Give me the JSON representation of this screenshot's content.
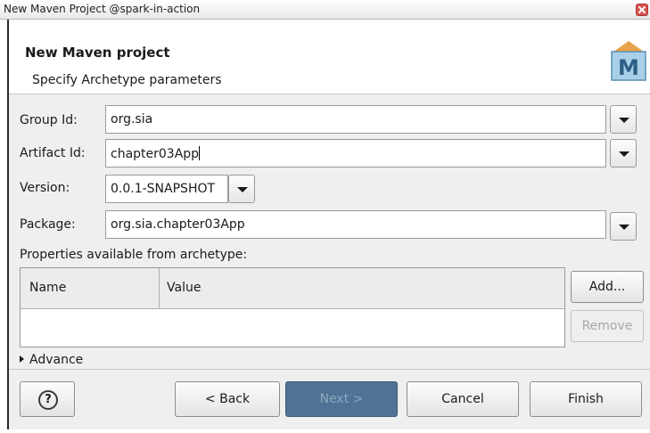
{
  "window": {
    "title": "New Maven Project @spark-in-action"
  },
  "banner": {
    "heading": "New Maven project",
    "subheading": "Specify Archetype parameters",
    "logo_letter": "M"
  },
  "form": {
    "group_id": {
      "label": "Group Id:",
      "value": "org.sia"
    },
    "artifact_id": {
      "label": "Artifact Id:",
      "value": "chapter03App"
    },
    "version": {
      "label": "Version:",
      "value": "0.0.1-SNAPSHOT"
    },
    "package": {
      "label": "Package:",
      "value": "org.sia.chapter03App"
    }
  },
  "properties": {
    "label": "Properties available from archetype:",
    "columns": [
      "Name",
      "Value"
    ],
    "add_label": "Add...",
    "remove_label": "Remove"
  },
  "advanced": {
    "label": "Advance"
  },
  "footer": {
    "help_icon": "?",
    "back_label": "< Back",
    "next_label": "Next >",
    "cancel_label": "Cancel",
    "finish_label": "Finish"
  },
  "icons": {
    "logo": "maven-m-logo",
    "dropdown": "chevron-down-icon",
    "help": "question-circle-icon",
    "expand": "triangle-right-icon"
  },
  "colors": {
    "next_button_bg": "#4f7394",
    "close_button": "#d9534f"
  }
}
